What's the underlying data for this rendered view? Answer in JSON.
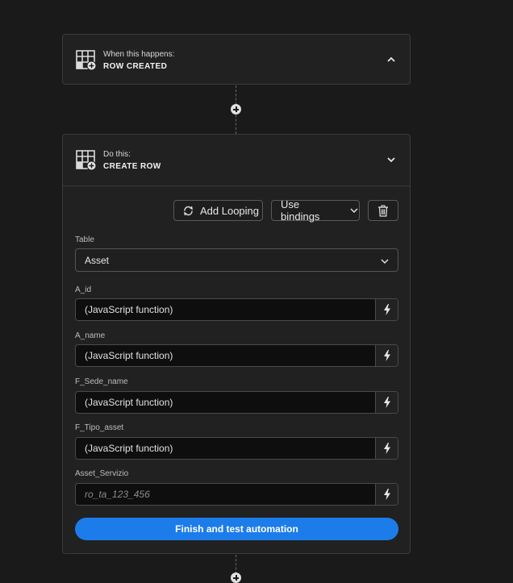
{
  "trigger": {
    "label": "When this happens:",
    "title": "ROW CREATED",
    "icon": "table-add-icon",
    "chevron": "chevron-up-icon"
  },
  "action": {
    "label": "Do this:",
    "title": "CREATE ROW",
    "icon": "table-add-icon",
    "chevron": "chevron-down-icon",
    "toolbar": {
      "looping_label": "Add Looping",
      "bindings_label": "Use bindings",
      "delete_icon": "trash-icon"
    },
    "table": {
      "label": "Table",
      "value": "Asset"
    },
    "fields": [
      {
        "label": "A_id",
        "value": "(JavaScript function)"
      },
      {
        "label": "A_name",
        "value": "(JavaScript function)"
      },
      {
        "label": "F_Sede_name",
        "value": "(JavaScript function)"
      },
      {
        "label": "F_Tipo_asset",
        "value": "(JavaScript function)"
      },
      {
        "label": "Asset_Servizio",
        "value": "",
        "placeholder": "ro_ta_123_456"
      }
    ],
    "finish_label": "Finish and test automation"
  },
  "colors": {
    "background": "#1a1a1a",
    "card": "#212121",
    "primary": "#1c7cea",
    "input": "#0e0e0e"
  }
}
